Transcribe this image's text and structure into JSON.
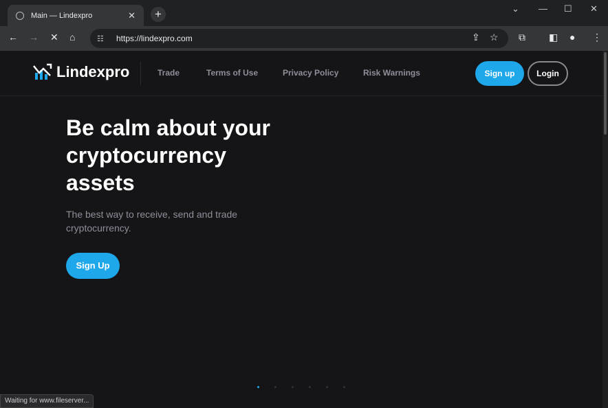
{
  "browser": {
    "tab_title": "Main — Lindexpro",
    "url": "https://lindexpro.com",
    "status": "Waiting for www.fileserver..."
  },
  "site": {
    "brand": "Lindexpro",
    "nav": [
      "Trade",
      "Terms of Use",
      "Privacy Policy",
      "Risk Warnings"
    ],
    "signup_label": "Sign up",
    "login_label": "Login",
    "hero_title": "Be calm about your cryptocurrency assets",
    "hero_subtitle": "The best way to receive, send and trade cryptocurrency.",
    "cta_label": "Sign Up",
    "slider": {
      "count": 6,
      "active": 1
    },
    "accent": "#1ea7ea"
  }
}
